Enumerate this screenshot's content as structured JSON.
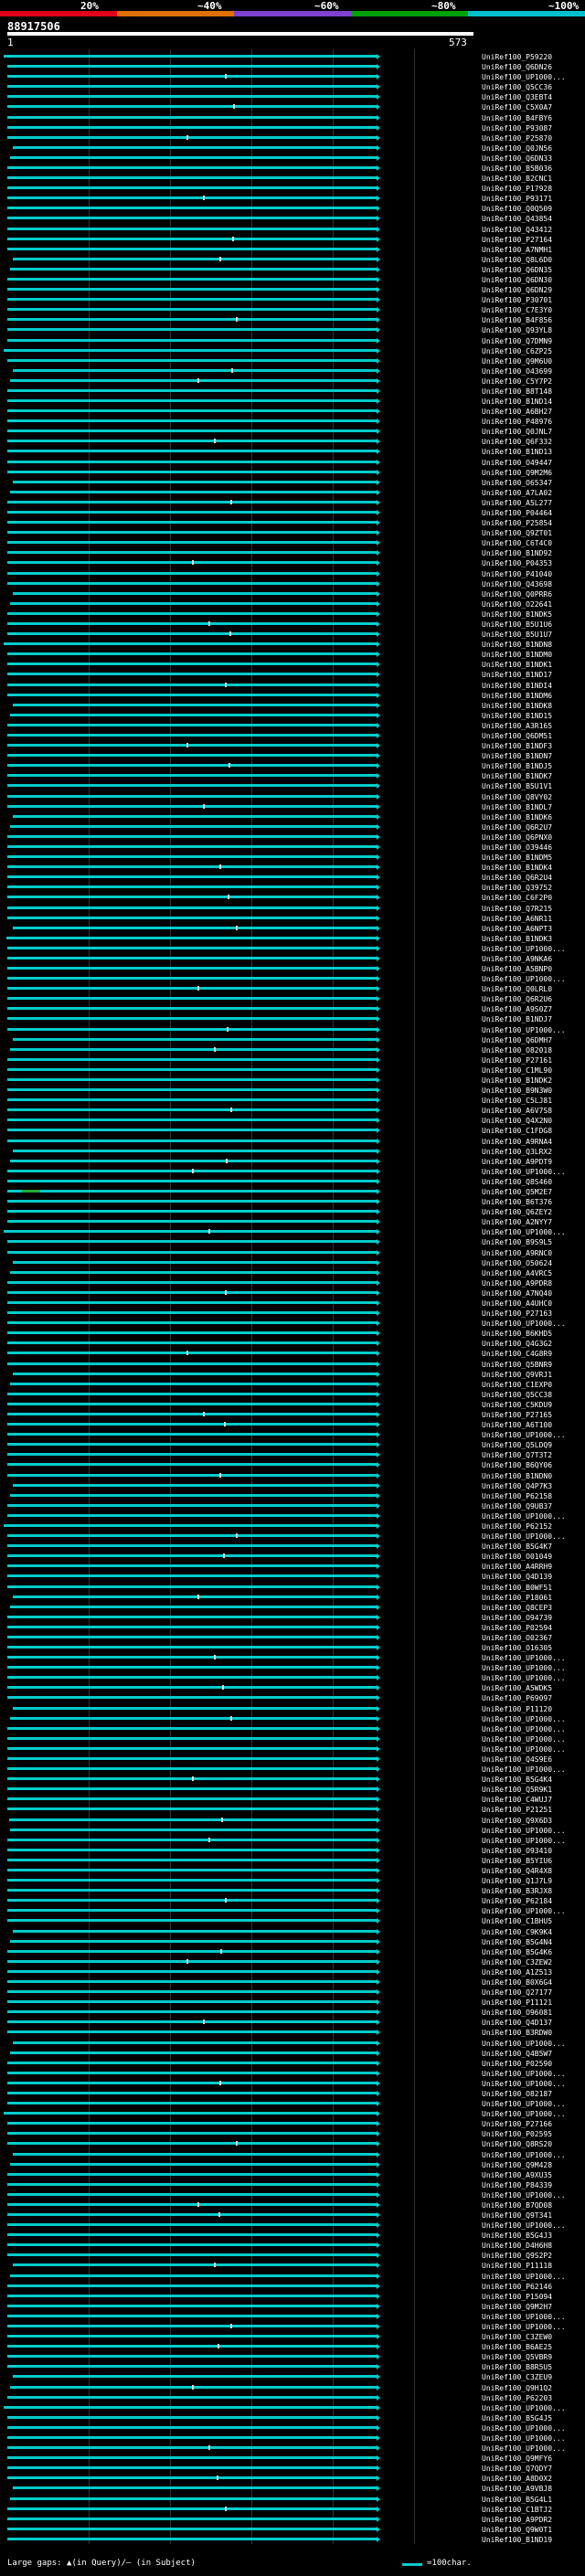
{
  "identity_scale": {
    "labels": [
      "20%",
      "~40%",
      "~60%",
      "~80%",
      "~100%"
    ],
    "colors": [
      "#e0001a",
      "#e07000",
      "#8040d0",
      "#00a000",
      "#00c0d0"
    ]
  },
  "query": {
    "id": "88917506",
    "start": "1",
    "end": "573"
  },
  "hits": [
    "UniRef100_P59220",
    "UniRef100_Q6DN26",
    "UniRef100_UP1000...",
    "UniRef100_Q5CC36",
    "UniRef100_Q3EBT4",
    "UniRef100_C5X0A7",
    "UniRef100_B4FBY6",
    "UniRef100_P93087",
    "UniRef100_P25870",
    "UniRef100_Q0JN56",
    "UniRef100_Q6DN33",
    "UniRef100_B5B036",
    "UniRef100_B2CNC1",
    "UniRef100_P17928",
    "UniRef100_P93171",
    "UniRef100_Q0Q509",
    "UniRef100_Q43854",
    "UniRef100_Q43412",
    "UniRef100_P27164",
    "UniRef100_A7NMH1",
    "UniRef100_Q8L6D0",
    "UniRef100_Q6DN35",
    "UniRef100_Q6DN30",
    "UniRef100_Q6DN29",
    "UniRef100_P30701",
    "UniRef100_C7E3Y0",
    "UniRef100_B4F856",
    "UniRef100_Q93YL8",
    "UniRef100_Q7DMN9",
    "UniRef100_C6ZP25",
    "UniRef100_Q9M6U0",
    "UniRef100_O43699",
    "UniRef100_C5Y7P2",
    "UniRef100_B8T148",
    "UniRef100_B1ND14",
    "UniRef100_A6BH27",
    "UniRef100_P48976",
    "UniRef100_Q0JNL7",
    "UniRef100_Q6F332",
    "UniRef100_B1ND13",
    "UniRef100_O49447",
    "UniRef100_Q9M2M6",
    "UniRef100_O65347",
    "UniRef100_A7LA02",
    "UniRef100_A5L277",
    "UniRef100_P04464",
    "UniRef100_P25854",
    "UniRef100_Q9ZT01",
    "UniRef100_C6T4C0",
    "UniRef100_B1ND92",
    "UniRef100_P04353",
    "UniRef100_P41040",
    "UniRef100_Q43698",
    "UniRef100_Q0PRR6",
    "UniRef100_O22641",
    "UniRef100_B1NDK5",
    "UniRef100_B5U1U6",
    "UniRef100_B5U1U7",
    "UniRef100_B1NDN8",
    "UniRef100_B1NDM0",
    "UniRef100_B1NDK1",
    "UniRef100_B1ND17",
    "UniRef100_B1NDI4",
    "UniRef100_B1NDM6",
    "UniRef100_B1NDK8",
    "UniRef100_B1ND15",
    "UniRef100_A3R165",
    "UniRef100_Q6DM51",
    "UniRef100_B1NDF3",
    "UniRef100_B1NDN7",
    "UniRef100_B1NDJ5",
    "UniRef100_B1NDK7",
    "UniRef100_B5U1V1",
    "UniRef100_Q8VY02",
    "UniRef100_B1NDL7",
    "UniRef100_B1NDK6",
    "UniRef100_Q6R2U7",
    "UniRef100_Q6PNX0",
    "UniRef100_O39446",
    "UniRef100_B1NDM5",
    "UniRef100_B1NDK4",
    "UniRef100_Q6R2U4",
    "UniRef100_Q39752",
    "UniRef100_C6F2P0",
    "UniRef100_Q7R215",
    "UniRef100_A6NR11",
    "UniRef100_A6NPT3",
    "UniRef100_B1NDK3",
    "UniRef100_UP1000...",
    "UniRef100_A9NKA6",
    "UniRef100_A5BNP0",
    "UniRef100_UP1000...",
    "UniRef100_Q0LRL0",
    "UniRef100_Q6R2U6",
    "UniRef100_A9S0Z7",
    "UniRef100_B1NDJ7",
    "UniRef100_UP1000...",
    "UniRef100_Q6DMH7",
    "UniRef100_O82018",
    "UniRef100_P27161",
    "UniRef100_C1ML90",
    "UniRef100_B1NDK2",
    "UniRef100_B9N3W0",
    "UniRef100_C5LJ81",
    "UniRef100_A6V7S8",
    "UniRef100_Q4X2N0",
    "UniRef100_C1FDG8",
    "UniRef100_A9RNA4",
    "UniRef100_Q3LRX2",
    "UniRef100_A9PDT9",
    "UniRef100_UP1000...",
    "UniRef100_Q8S460",
    "UniRef100_Q5M2E7",
    "UniRef100_B6T376",
    "UniRef100_Q6ZEY2",
    "UniRef100_A2NYY7",
    "UniRef100_UP1000...",
    "UniRef100_B9S9L5",
    "UniRef100_A9RNC0",
    "UniRef100_O50624",
    "UniRef100_A4VRC5",
    "UniRef100_A9PDR8",
    "UniRef100_A7NQ40",
    "UniRef100_A4UHC0",
    "UniRef100_P27163",
    "UniRef100_UP1000...",
    "UniRef100_B6KHD5",
    "UniRef100_Q4G3G2",
    "UniRef100_C4G8R9",
    "UniRef100_Q5BNR9",
    "UniRef100_Q9VRJ1",
    "UniRef100_C1EXP0",
    "UniRef100_Q5CC38",
    "UniRef100_C5KDU9",
    "UniRef100_P27165",
    "UniRef100_A6T100",
    "UniRef100_UP1000...",
    "UniRef100_Q5LDQ9",
    "UniRef100_Q7T3T2",
    "UniRef100_B6QY06",
    "UniRef100_B1NDN0",
    "UniRef100_Q4P7K3",
    "UniRef100_P62158",
    "UniRef100_Q9UB37",
    "UniRef100_UP1000...",
    "UniRef100_P62152",
    "UniRef100_UP1000...",
    "UniRef100_B5G4K7",
    "UniRef100_O01049",
    "UniRef100_A4RRH9",
    "UniRef100_Q4D139",
    "UniRef100_B0WF51",
    "UniRef100_P18061",
    "UniRef100_Q8CEP3",
    "UniRef100_O94739",
    "UniRef100_P02594",
    "UniRef100_O02367",
    "UniRef100_O16305",
    "UniRef100_UP1000...",
    "UniRef100_UP1000...",
    "UniRef100_UP1000...",
    "UniRef100_A5WDK5",
    "UniRef100_P69097",
    "UniRef100_P11120",
    "UniRef100_UP1000...",
    "UniRef100_UP1000...",
    "UniRef100_UP1000...",
    "UniRef100_UP1000...",
    "UniRef100_Q4S9E6",
    "UniRef100_UP1000...",
    "UniRef100_B5G4K4",
    "UniRef100_Q5R9K1",
    "UniRef100_C4WUJ7",
    "UniRef100_P21251",
    "UniRef100_Q9X6D3",
    "UniRef100_UP1000...",
    "UniRef100_UP1000...",
    "UniRef100_O93410",
    "UniRef100_B5YIU6",
    "UniRef100_Q4R4X8",
    "UniRef100_Q1J7L9",
    "UniRef100_B3RJX8",
    "UniRef100_P62184",
    "UniRef100_UP1000...",
    "UniRef100_C1BHU5",
    "UniRef100_C9K9K4",
    "UniRef100_B5G4N4",
    "UniRef100_B5G4K6",
    "UniRef100_C3ZEW2",
    "UniRef100_A1Z513",
    "UniRef100_B0X6G4",
    "UniRef100_Q27177",
    "UniRef100_P11121",
    "UniRef100_O96081",
    "UniRef100_Q4D137",
    "UniRef100_B3RDW0",
    "UniRef100_UP1000...",
    "UniRef100_Q4B5W7",
    "UniRef100_P02590",
    "UniRef100_UP1000...",
    "UniRef100_UP1000...",
    "UniRef100_O82187",
    "UniRef100_UP1000...",
    "UniRef100_UP1000...",
    "UniRef100_P27166",
    "UniRef100_P02595",
    "UniRef100_Q8RS20",
    "UniRef100_UP1000...",
    "UniRef100_Q9M428",
    "UniRef100_A9XU35",
    "UniRef100_P84339",
    "UniRef100_UP1000...",
    "UniRef100_B7QD08",
    "UniRef100_Q9T341",
    "UniRef100_UP1000...",
    "UniRef100_B5G4J3",
    "UniRef100_D4H6H8",
    "UniRef100_Q9S2P2",
    "UniRef100_P11118",
    "UniRef100_UP1000...",
    "UniRef100_P62146",
    "UniRef100_P15094",
    "UniRef100_Q9M2H7",
    "UniRef100_UP1000...",
    "UniRef100_UP1000...",
    "UniRef100_C3ZEW0",
    "UniRef100_B6AE25",
    "UniRef100_Q5VBR9",
    "UniRef100_B8R5U5",
    "UniRef100_C3ZEU9",
    "UniRef100_Q9H1Q2",
    "UniRef100_P62203",
    "UniRef100_UP1000...",
    "UniRef100_B5G4J5",
    "UniRef100_UP1000...",
    "UniRef100_UP1000...",
    "UniRef100_UP1000...",
    "UniRef100_Q9MFY6",
    "UniRef100_Q7QDY7",
    "UniRef100_A8D0X2",
    "UniRef100_A9VBJ8",
    "UniRef100_B5G4L1",
    "UniRef100_C1BTJ2",
    "UniRef100_A9PDR2",
    "UniRef100_Q9W0T1",
    "UniRef100_B1ND19"
  ],
  "legend": {
    "left": "Large gaps: ▲(in Query)/– (in Subject)",
    "right": "=100char."
  }
}
